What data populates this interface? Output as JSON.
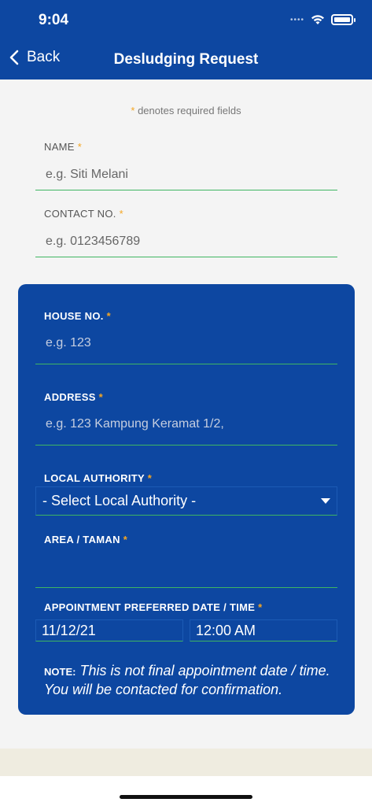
{
  "status_bar": {
    "time": "9:04",
    "signal_dots": "••••"
  },
  "nav": {
    "back_label": "Back",
    "title": "Desludging Request"
  },
  "required_note": {
    "asterisk": "*",
    "text": " denotes required fields"
  },
  "fields": {
    "name": {
      "label": "NAME",
      "placeholder": "e.g. Siti Melani"
    },
    "contact": {
      "label": "CONTACT NO.",
      "placeholder": "e.g. 0123456789"
    },
    "house": {
      "label": "HOUSE NO.",
      "placeholder": "e.g. 123"
    },
    "address": {
      "label": "ADDRESS",
      "placeholder": "e.g. 123 Kampung Keramat 1/2,"
    },
    "local_authority": {
      "label": "LOCAL AUTHORITY",
      "value": "- Select Local Authority -"
    },
    "area": {
      "label": "AREA / TAMAN",
      "placeholder": ""
    },
    "appointment": {
      "label": "APPOINTMENT PREFERRED DATE / TIME",
      "date": "11/12/21",
      "time": "12:00 AM"
    }
  },
  "asterisk": "*",
  "note": {
    "label": "NOTE:",
    "text": "This is not final appointment date / time. You will be contacted for confirmation."
  },
  "colors": {
    "primary": "#0d47a1",
    "accent_green": "#3fb562",
    "required": "#f5a623"
  },
  "icons": {
    "back": "chevron-left-icon",
    "wifi": "wifi-icon",
    "battery": "battery-icon",
    "dropdown": "caret-down-icon"
  }
}
